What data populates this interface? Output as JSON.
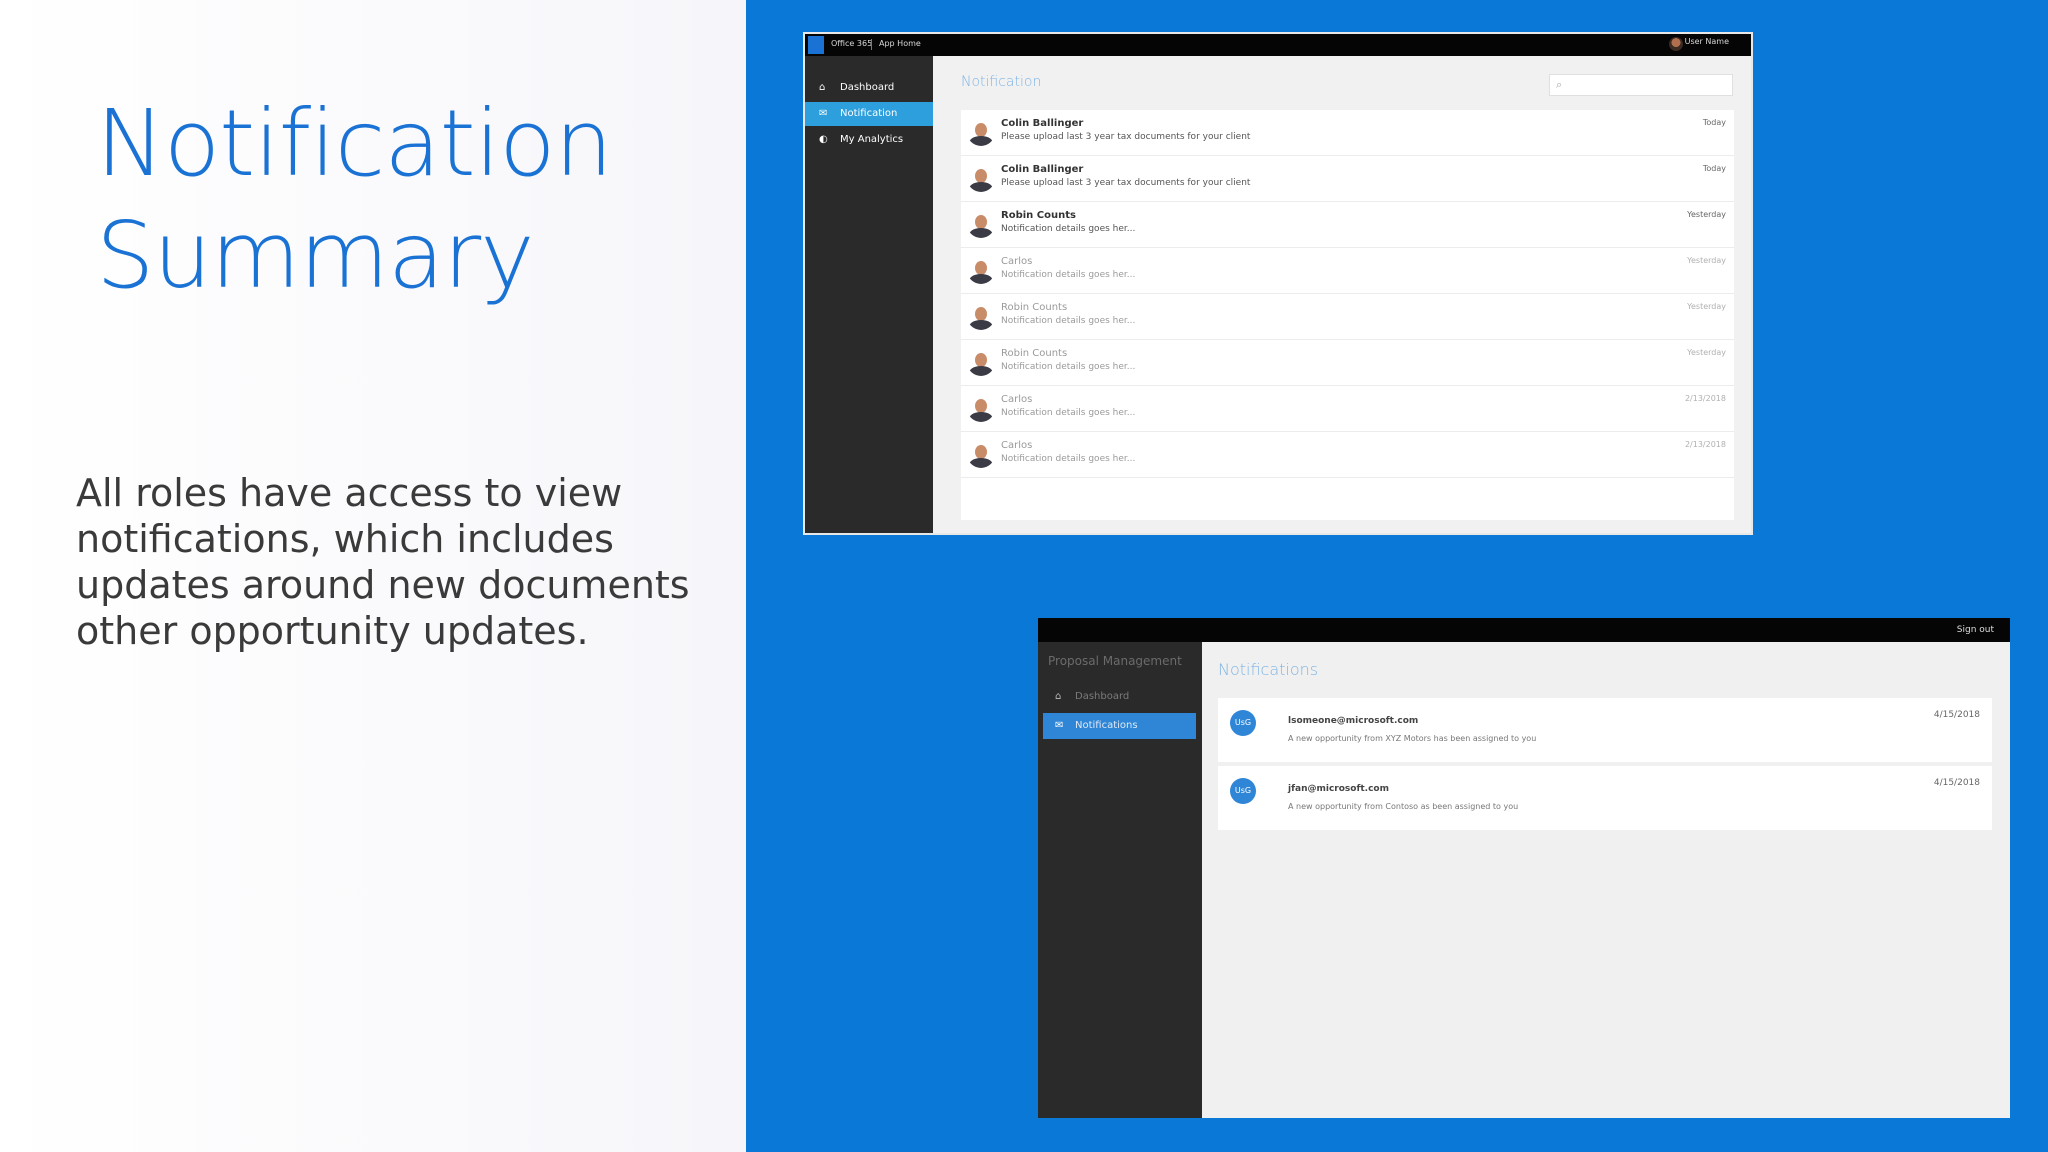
{
  "slide": {
    "title_line1": "Notification",
    "title_line2": "Summary",
    "body": "All roles have access to view notifications, which includes updates around new documents other opportunity updates."
  },
  "colors": {
    "title": "#1a73d4",
    "background_blue": "#0a78d7",
    "active_nav": "#2d9fdc"
  },
  "screenshot1": {
    "topbar": {
      "app_name": "Office 365",
      "app_home": "App Home",
      "user_name": "User Name"
    },
    "sidebar": [
      {
        "label": "Dashboard",
        "icon": "home-icon",
        "active": false
      },
      {
        "label": "Notification",
        "icon": "notification-icon",
        "active": true
      },
      {
        "label": "My Analytics",
        "icon": "analytics-icon",
        "active": false
      }
    ],
    "heading": "Notification",
    "search_placeholder": "",
    "rows": [
      {
        "name": "Colin Ballinger",
        "detail": "Please upload last 3 year tax documents for your client",
        "date": "Today",
        "faded": false
      },
      {
        "name": "Colin Ballinger",
        "detail": "Please upload last 3 year tax documents for your client",
        "date": "Today",
        "faded": false
      },
      {
        "name": "Robin Counts",
        "detail": "Notification details goes her...",
        "date": "Yesterday",
        "faded": false
      },
      {
        "name": "Carlos",
        "detail": "Notification details goes her...",
        "date": "Yesterday",
        "faded": true
      },
      {
        "name": "Robin Counts",
        "detail": "Notification details goes her...",
        "date": "Yesterday",
        "faded": true
      },
      {
        "name": "Robin Counts",
        "detail": "Notification details goes her...",
        "date": "Yesterday",
        "faded": true
      },
      {
        "name": "Carlos",
        "detail": "Notification details goes her...",
        "date": "2/13/2018",
        "faded": true
      },
      {
        "name": "Carlos",
        "detail": "Notification details goes her...",
        "date": "2/13/2018",
        "faded": true
      }
    ]
  },
  "screenshot2": {
    "topbar": {
      "signout": "Sign out"
    },
    "app_title": "Proposal Management",
    "sidebar": [
      {
        "label": "Dashboard",
        "icon": "home-icon",
        "active": false
      },
      {
        "label": "Notifications",
        "icon": "notification-icon",
        "active": true
      }
    ],
    "heading": "Notifications",
    "cards": [
      {
        "badge": "UsG",
        "email": "lsomeone@microsoft.com",
        "message": "A new opportunity from XYZ Motors has been assigned to you",
        "date": "4/15/2018"
      },
      {
        "badge": "UsG",
        "email": "jfan@microsoft.com",
        "message": "A new opportunity from Contoso as been assigned to you",
        "date": "4/15/2018"
      }
    ]
  }
}
